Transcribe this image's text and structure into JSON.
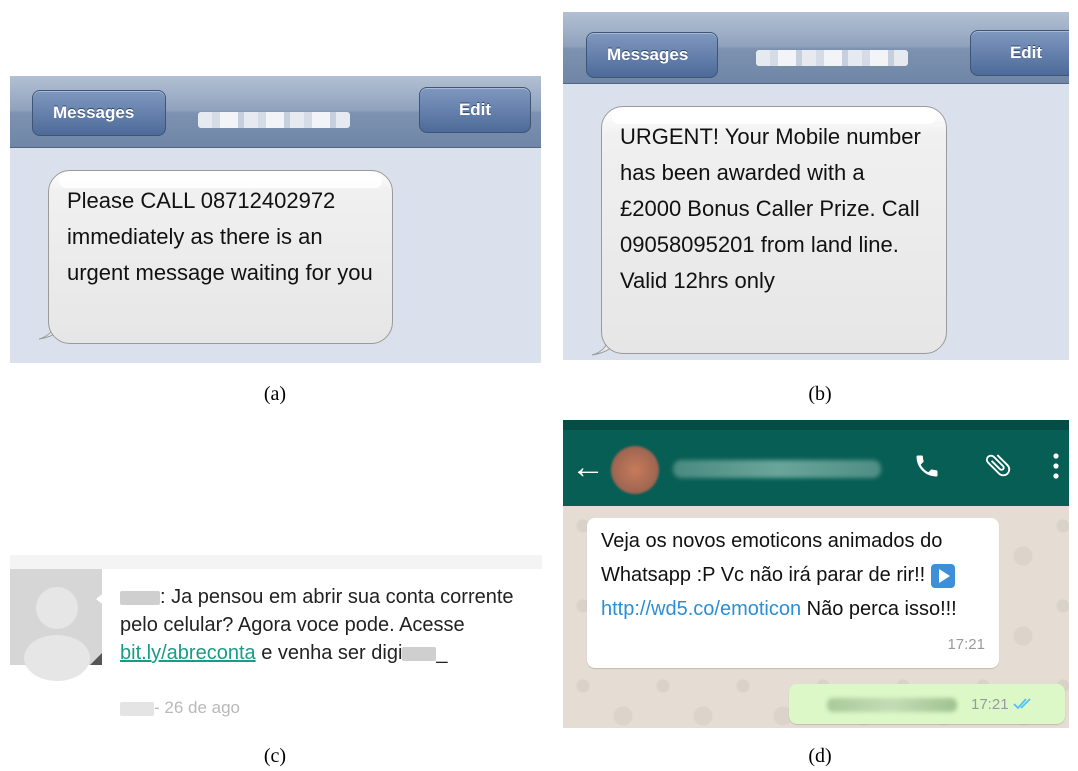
{
  "panel_a": {
    "nav_back": "Messages",
    "nav_edit": "Edit",
    "message": "Please CALL 08712402972 immediately as there is an urgent message waiting for you",
    "caption": "(a)"
  },
  "panel_b": {
    "nav_back": "Messages",
    "nav_edit": "Edit",
    "message": "URGENT! Your Mobile number has been awarded with a £2000 Bonus Caller Prize. Call 09058095201 from land line. Valid 12hrs only",
    "caption": "(b)"
  },
  "panel_c": {
    "text_before": ": Ja pensou em abrir sua conta corrente pelo celular? Agora voce pode. Acesse ",
    "link": "bit.ly/abreconta",
    "text_after": " e venha ser digi",
    "text_end": "_",
    "meta": "- 26 de ago",
    "caption": "(c)"
  },
  "panel_d": {
    "incoming_text": "Veja os novos emoticons animados do Whatsapp :P Vc não irá parar de rir!! ",
    "incoming_link": "http://wd5.co/emoticon",
    "incoming_after": " Não perca isso!!!",
    "incoming_time": "17:21",
    "outgoing_time": "17:21",
    "caption": "(d)",
    "icons": [
      "back-arrow-icon",
      "phone-icon",
      "paperclip-icon",
      "more-vert-icon",
      "double-check-icon"
    ],
    "colors": {
      "header": "#075e54",
      "link": "#2b8fd6",
      "read_check": "#4fc3f7"
    }
  }
}
